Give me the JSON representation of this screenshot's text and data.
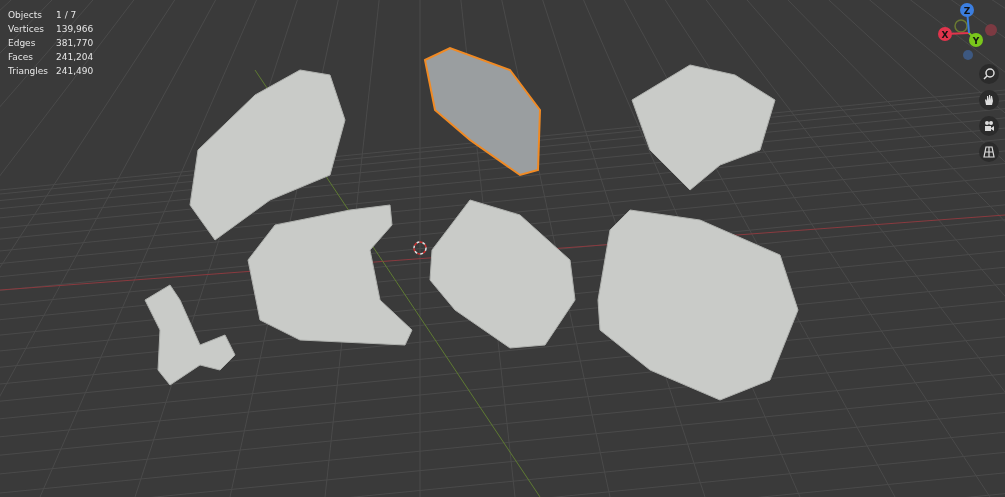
{
  "stats": [
    {
      "label": "Objects",
      "value": "1 / 7"
    },
    {
      "label": "Vertices",
      "value": "139,966"
    },
    {
      "label": "Edges",
      "value": "381,770"
    },
    {
      "label": "Faces",
      "value": "241,204"
    },
    {
      "label": "Triangles",
      "value": "241,490"
    }
  ],
  "gizmo": {
    "axes": [
      {
        "label": "X",
        "kind": "x"
      },
      {
        "label": "Y",
        "kind": "y"
      },
      {
        "label": "Z",
        "kind": "z"
      }
    ]
  },
  "nav_tools": [
    {
      "kind": "zoom"
    },
    {
      "kind": "pan"
    },
    {
      "kind": "camera"
    },
    {
      "kind": "grid"
    }
  ],
  "objects": [
    {
      "selected": false
    },
    {
      "selected": true
    },
    {
      "selected": false
    },
    {
      "selected": false
    },
    {
      "selected": false
    },
    {
      "selected": false
    },
    {
      "selected": false
    }
  ]
}
